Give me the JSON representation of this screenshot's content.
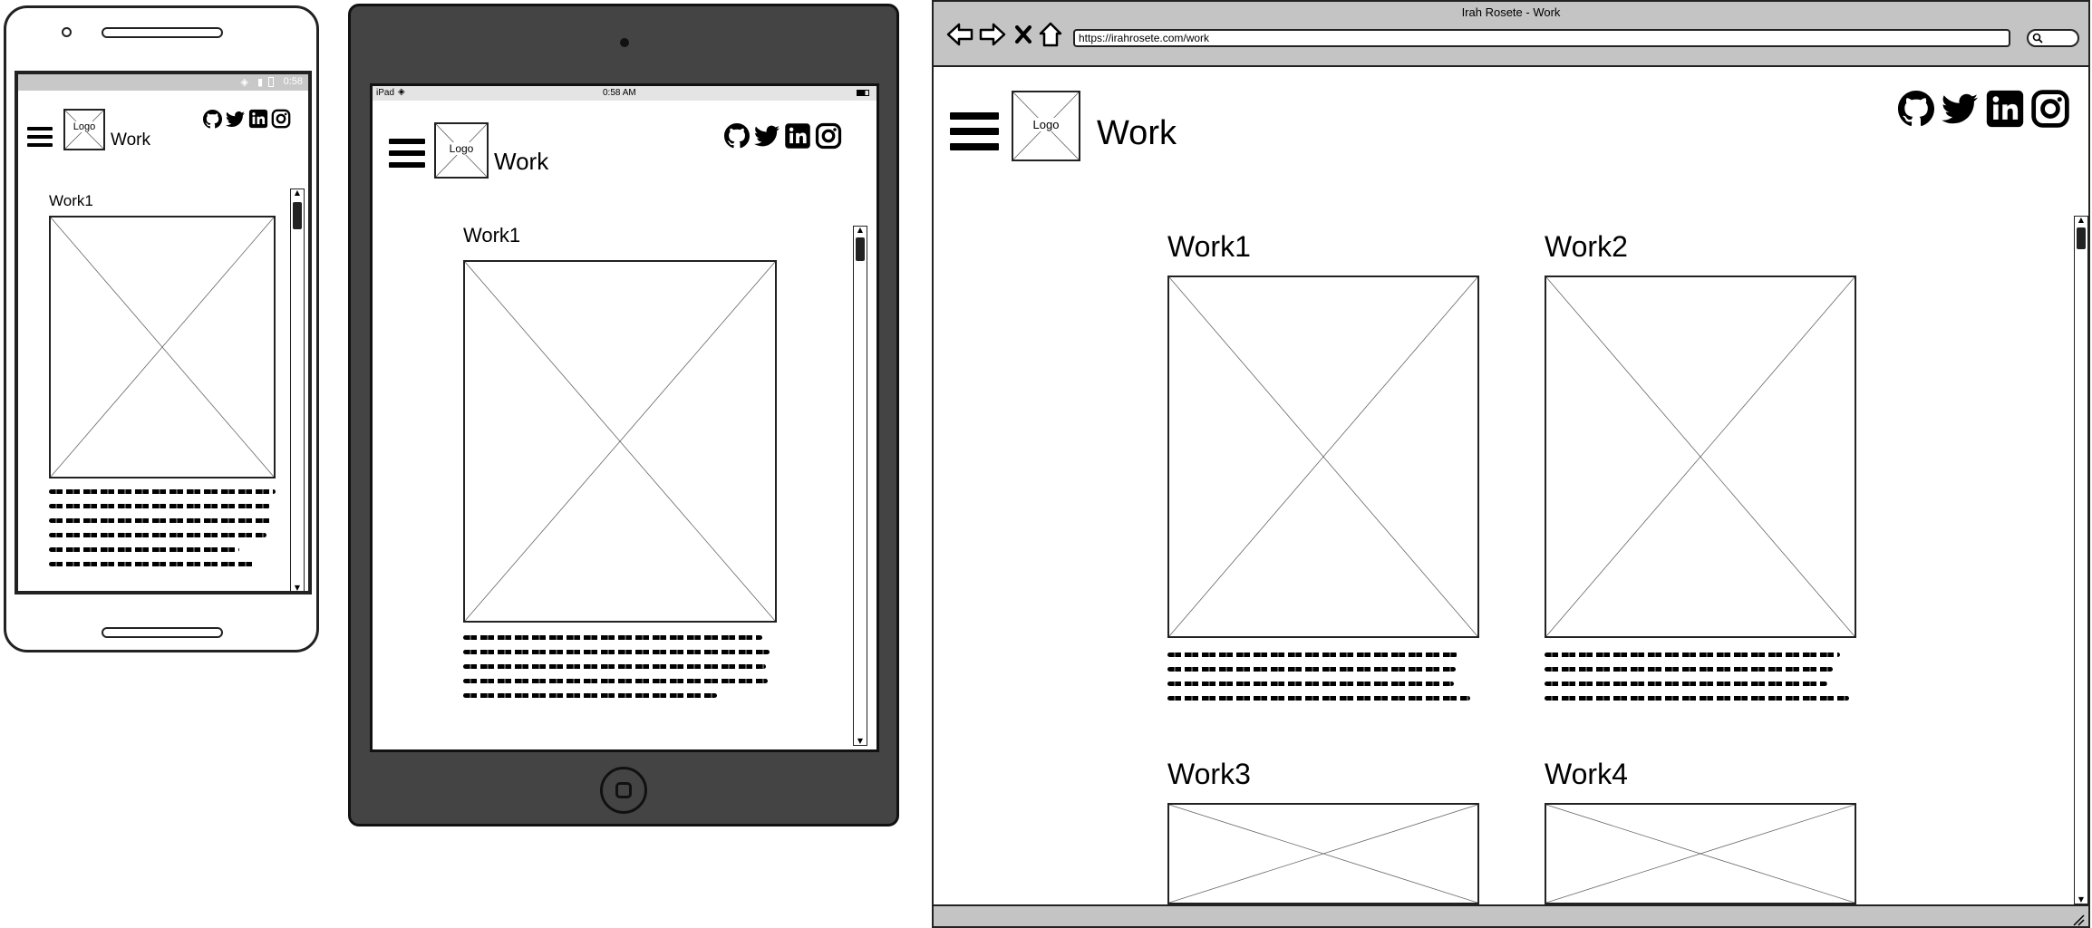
{
  "page_heading": "Work",
  "logo_label": "Logo",
  "phone": {
    "status_time": "0:58",
    "work_items": [
      {
        "title": "Work1"
      }
    ]
  },
  "tablet": {
    "status_carrier": "iPad",
    "status_time": "0:58 AM",
    "work_items": [
      {
        "title": "Work1"
      }
    ]
  },
  "browser": {
    "window_title": "Irah Rosete - Work",
    "url": "https://irahrosete.com/work",
    "work_items": [
      {
        "title": "Work1"
      },
      {
        "title": "Work2"
      },
      {
        "title": "Work3"
      },
      {
        "title": "Work4"
      }
    ]
  },
  "social_icons": [
    "github-icon",
    "twitter-icon",
    "linkedin-icon",
    "instagram-icon"
  ],
  "colors": {
    "tablet_frame": "#444444",
    "browser_chrome": "#c0c0c0",
    "outline": "#222222"
  }
}
